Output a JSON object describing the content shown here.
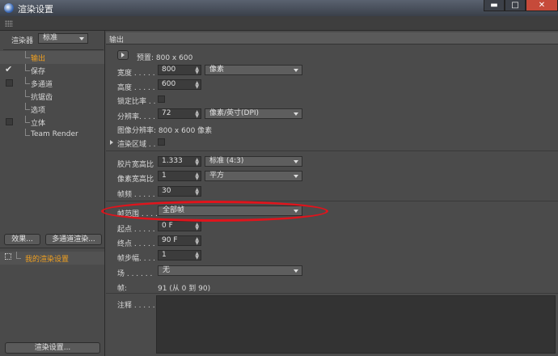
{
  "window": {
    "title": "渲染设置",
    "minimize": "▬",
    "maximize": "□",
    "close": "✕"
  },
  "sidebar": {
    "renderer_label": "渲染器",
    "renderer_value": "标准",
    "items": [
      {
        "label": "输出",
        "selected": true
      },
      {
        "label": "保存",
        "checked": true
      },
      {
        "label": "多通道"
      },
      {
        "label": "抗锯齿"
      },
      {
        "label": "选项"
      },
      {
        "label": "立体"
      },
      {
        "label": "Team Render"
      }
    ],
    "effects_button": "效果...",
    "multipass_button": "多通道渲染...",
    "settings_item": "我的渲染设置",
    "render_settings_button": "渲染设置..."
  },
  "output": {
    "header": "输出",
    "preset_label": "预置: 800 x 600",
    "width_label": "宽度 . . . . .",
    "width_value": "800",
    "width_unit": "像素",
    "height_label": "高度 . . . . .",
    "height_value": "600",
    "lock_ratio_label": "锁定比率 . .",
    "resolution_label": "分辨率. . . .",
    "resolution_value": "72",
    "resolution_unit": "像素/英寸(DPI)",
    "image_resolution": "图像分辨率: 800 x 600 像素",
    "render_region_label": "渲染区域 . .",
    "film_aspect_label": "胶片宽高比",
    "film_aspect_value": "1.333",
    "film_aspect_combo": "标准 (4:3)",
    "pixel_aspect_label": "像素宽高比",
    "pixel_aspect_value": "1",
    "pixel_aspect_combo": "平方",
    "fps_label": "帧频 . . . . .",
    "fps_value": "30",
    "frame_range_label": "帧范围 . . . .",
    "frame_range_value": "全部帧",
    "start_label": "起点 . . . . .",
    "start_value": "0 F",
    "end_label": "终点 . . . . .",
    "end_value": "90 F",
    "frame_step_label": "帧步幅. . . .",
    "frame_step_value": "1",
    "field_label": "场 . . . . . .",
    "field_value": "无",
    "frames_label": "帧:",
    "frames_value": "91 (从 0 到 90)",
    "notes_label": "注释 . . . . ."
  },
  "colors": {
    "highlight_ellipse": "#e0141c",
    "selected_text": "#f0a020"
  }
}
